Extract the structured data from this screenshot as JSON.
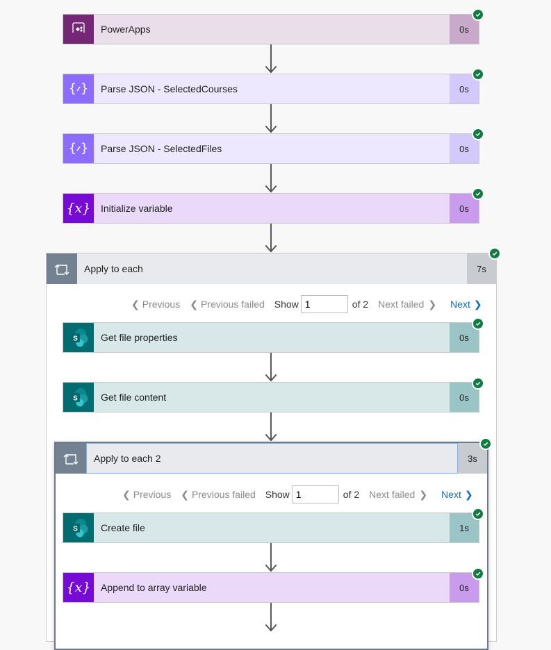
{
  "status_icon": "success-check-icon",
  "colors": {
    "powerapps_icon": "#742774",
    "powerapps_body": "#eadeea",
    "powerapps_dur": "#c8a9c9",
    "parsejson_icon": "#8c6cff",
    "parsejson_body": "#ede8fd",
    "parsejson_dur": "#d4c9fb",
    "variable_icon": "#770bd6",
    "variable_body": "#ead9f8",
    "variable_dur": "#c99bed",
    "sharepoint_icon": "#036c70",
    "sharepoint_body": "#d8e7e8",
    "sharepoint_dur": "#9ac4c6",
    "scope_icon": "#738191",
    "success": "#107c41",
    "link": "#0f6cbd"
  },
  "steps": [
    {
      "title": "PowerApps",
      "duration": "0s",
      "icon": "powerapps-icon"
    },
    {
      "title": "Parse JSON - SelectedCourses",
      "duration": "0s",
      "icon": "parse-json-icon"
    },
    {
      "title": "Parse JSON - SelectedFiles",
      "duration": "0s",
      "icon": "parse-json-icon"
    },
    {
      "title": "Initialize variable",
      "duration": "0s",
      "icon": "variable-icon"
    }
  ],
  "loop1": {
    "title": "Apply to each",
    "duration": "7s",
    "icon": "loop-icon",
    "pager": {
      "previous": "Previous",
      "previous_failed": "Previous failed",
      "show": "Show",
      "value": "1",
      "of": "of 2",
      "next_failed": "Next failed",
      "next": "Next"
    },
    "steps": [
      {
        "title": "Get file properties",
        "duration": "0s",
        "icon": "sharepoint-icon"
      },
      {
        "title": "Get file content",
        "duration": "0s",
        "icon": "sharepoint-icon"
      }
    ]
  },
  "loop2": {
    "title": "Apply to each 2",
    "duration": "3s",
    "icon": "loop-icon",
    "pager": {
      "previous": "Previous",
      "previous_failed": "Previous failed",
      "show": "Show",
      "value": "1",
      "of": "of 2",
      "next_failed": "Next failed",
      "next": "Next"
    },
    "steps": [
      {
        "title": "Create file",
        "duration": "1s",
        "icon": "sharepoint-icon"
      },
      {
        "title": "Append to array variable",
        "duration": "0s",
        "icon": "variable-icon"
      }
    ]
  }
}
